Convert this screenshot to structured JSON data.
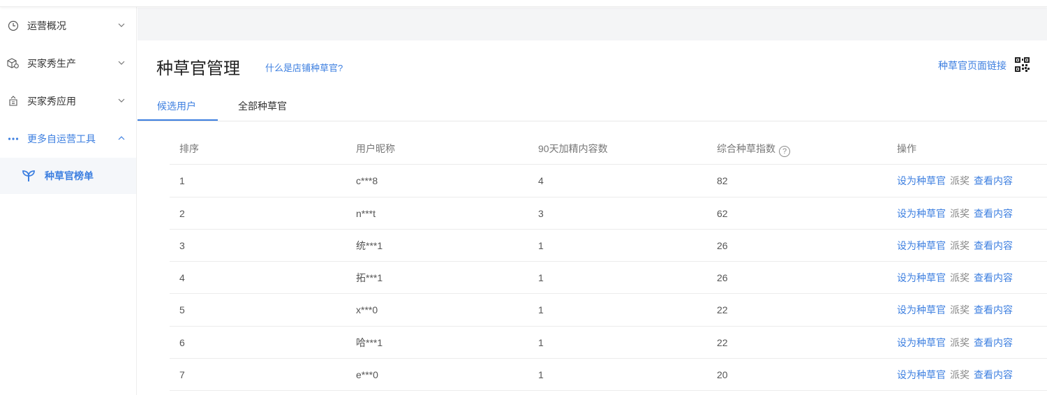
{
  "sidebar": {
    "groups": [
      {
        "label": "运营概况",
        "icon": "clock-icon"
      },
      {
        "label": "买家秀生产",
        "icon": "box-gear-icon"
      },
      {
        "label": "买家秀应用",
        "icon": "store-icon"
      },
      {
        "label": "更多自运营工具",
        "icon": "more-dots-icon"
      }
    ],
    "sub_item": {
      "label": "种草官榜单",
      "icon": "sprout-icon"
    }
  },
  "header": {
    "title": "种草官管理",
    "help_link": "什么是店铺种草官?",
    "page_link": "种草官页面链接",
    "qr_icon": "qr-code-icon"
  },
  "tabs": [
    {
      "label": "候选用户"
    },
    {
      "label": "全部种草官"
    }
  ],
  "table": {
    "columns": [
      "排序",
      "用户昵称",
      "90天加精内容数",
      "综合种草指数",
      "操作"
    ],
    "rows": [
      {
        "rank": "1",
        "nickname": "c***8",
        "count": "4",
        "index": "82"
      },
      {
        "rank": "2",
        "nickname": "n***t",
        "count": "3",
        "index": "62"
      },
      {
        "rank": "3",
        "nickname": "统***1",
        "count": "1",
        "index": "26"
      },
      {
        "rank": "4",
        "nickname": "拓***1",
        "count": "1",
        "index": "26"
      },
      {
        "rank": "5",
        "nickname": "x***0",
        "count": "1",
        "index": "22"
      },
      {
        "rank": "6",
        "nickname": "哈***1",
        "count": "1",
        "index": "22"
      },
      {
        "rank": "7",
        "nickname": "e***0",
        "count": "1",
        "index": "20"
      }
    ],
    "actions": {
      "set": "设为种草官",
      "reward": "派奖",
      "view": "查看内容"
    }
  },
  "colors": {
    "accent": "#3d7fe0",
    "muted": "#888888"
  }
}
